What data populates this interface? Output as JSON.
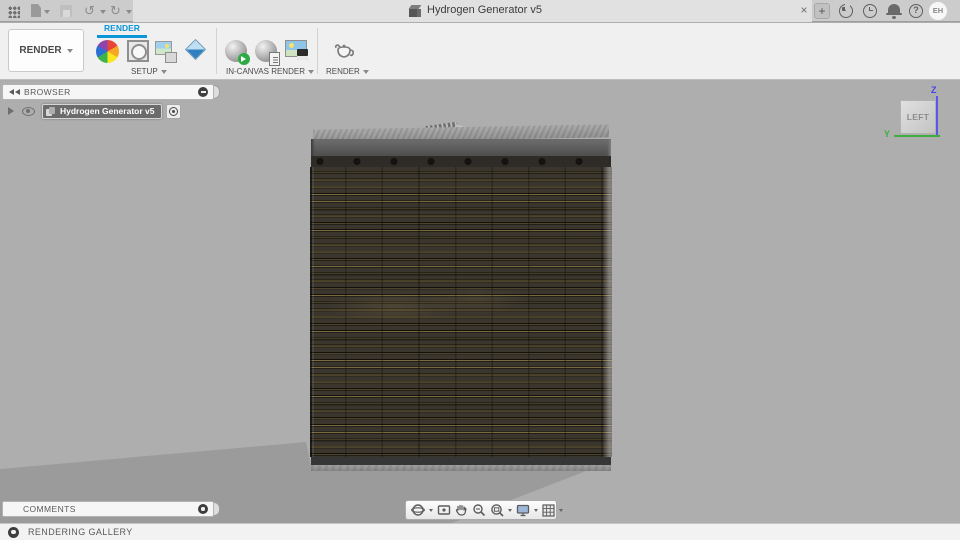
{
  "titlebar": {
    "title": "Hydrogen Generator v5",
    "close": "×",
    "new_tab": "+",
    "help": "?",
    "avatar": "EH",
    "undo_icon": "↺",
    "redo_icon": "↻"
  },
  "toolbar": {
    "workspace_button": "RENDER",
    "active_tab": "RENDER",
    "setup_group": "SETUP",
    "in_canvas_group": "IN-CANVAS RENDER",
    "render_group": "RENDER"
  },
  "browser": {
    "header": "BROWSER",
    "item": "Hydrogen Generator v5"
  },
  "comments": {
    "header": "COMMENTS"
  },
  "statusbar": {
    "label": "RENDERING GALLERY"
  },
  "viewcube": {
    "face": "LEFT",
    "axis_z": "Z",
    "axis_y": "Y"
  },
  "colors": {
    "accent_blue": "#0a96d7",
    "canvas_bg": "#aeaeae",
    "ground_shadow": "#9b9b9b",
    "fin_dark": "#3a362e",
    "fin_highlight": "#79693f",
    "axis_z": "#4343e6",
    "axis_y": "#3fae3f"
  }
}
